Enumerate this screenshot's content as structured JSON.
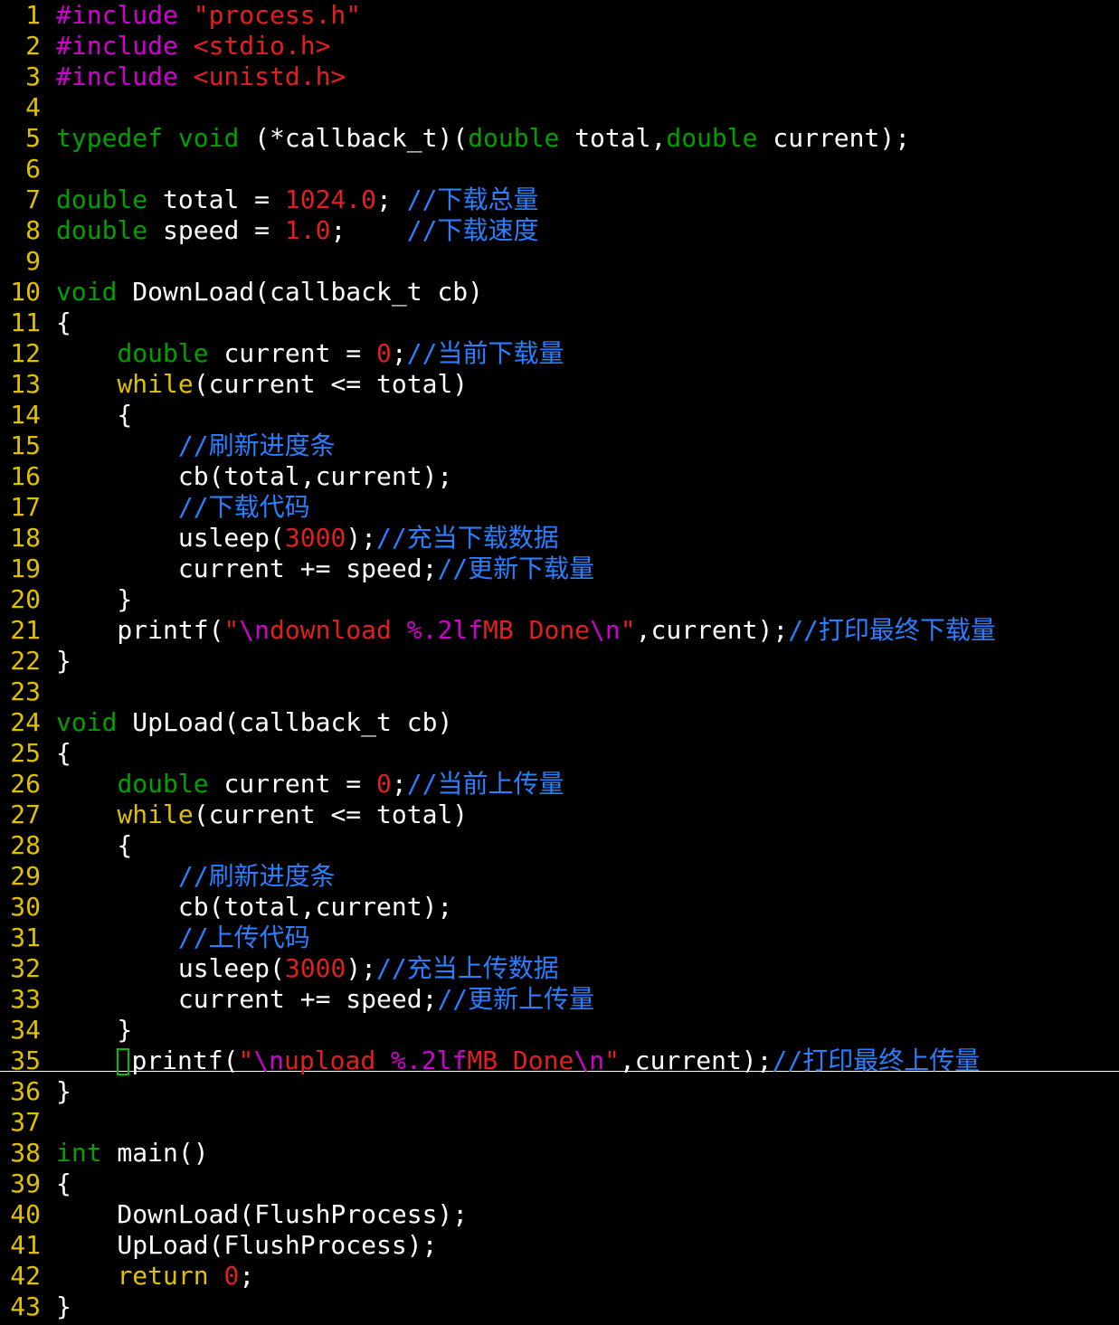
{
  "lines": [
    {
      "n": "1",
      "tokens": [
        [
          "pre",
          "#include "
        ],
        [
          "str",
          "\"process.h\""
        ]
      ]
    },
    {
      "n": "2",
      "tokens": [
        [
          "pre",
          "#include "
        ],
        [
          "str",
          "<stdio.h>"
        ]
      ]
    },
    {
      "n": "3",
      "tokens": [
        [
          "pre",
          "#include "
        ],
        [
          "str",
          "<unistd.h>"
        ]
      ]
    },
    {
      "n": "4",
      "tokens": []
    },
    {
      "n": "5",
      "tokens": [
        [
          "kw",
          "typedef"
        ],
        [
          "txt",
          " "
        ],
        [
          "kw",
          "void"
        ],
        [
          "txt",
          " (*callback_t)("
        ],
        [
          "kw",
          "double"
        ],
        [
          "txt",
          " total,"
        ],
        [
          "kw",
          "double"
        ],
        [
          "txt",
          " current);"
        ]
      ]
    },
    {
      "n": "6",
      "tokens": []
    },
    {
      "n": "7",
      "tokens": [
        [
          "kw",
          "double"
        ],
        [
          "txt",
          " total = "
        ],
        [
          "num",
          "1024.0"
        ],
        [
          "txt",
          "; "
        ],
        [
          "cmt",
          "//下载总量"
        ]
      ]
    },
    {
      "n": "8",
      "tokens": [
        [
          "kw",
          "double"
        ],
        [
          "txt",
          " speed = "
        ],
        [
          "num",
          "1.0"
        ],
        [
          "txt",
          ";    "
        ],
        [
          "cmt",
          "//下载速度"
        ]
      ]
    },
    {
      "n": "9",
      "tokens": []
    },
    {
      "n": "10",
      "tokens": [
        [
          "kw",
          "void"
        ],
        [
          "txt",
          " DownLoad(callback_t cb)"
        ]
      ]
    },
    {
      "n": "11",
      "tokens": [
        [
          "txt",
          "{"
        ]
      ]
    },
    {
      "n": "12",
      "tokens": [
        [
          "txt",
          "    "
        ],
        [
          "kw",
          "double"
        ],
        [
          "txt",
          " current = "
        ],
        [
          "num",
          "0"
        ],
        [
          "txt",
          ";"
        ],
        [
          "cmt",
          "//当前下载量"
        ]
      ]
    },
    {
      "n": "13",
      "tokens": [
        [
          "txt",
          "    "
        ],
        [
          "wkw",
          "while"
        ],
        [
          "txt",
          "(current <= total)"
        ]
      ]
    },
    {
      "n": "14",
      "tokens": [
        [
          "txt",
          "    {"
        ]
      ]
    },
    {
      "n": "15",
      "tokens": [
        [
          "txt",
          "        "
        ],
        [
          "cmt",
          "//刷新进度条"
        ]
      ]
    },
    {
      "n": "16",
      "tokens": [
        [
          "txt",
          "        cb(total,current);"
        ]
      ]
    },
    {
      "n": "17",
      "tokens": [
        [
          "txt",
          "        "
        ],
        [
          "cmt",
          "//下载代码"
        ]
      ]
    },
    {
      "n": "18",
      "tokens": [
        [
          "txt",
          "        usleep("
        ],
        [
          "num",
          "3000"
        ],
        [
          "txt",
          ");"
        ],
        [
          "cmt",
          "//充当下载数据"
        ]
      ]
    },
    {
      "n": "19",
      "tokens": [
        [
          "txt",
          "        current += speed;"
        ],
        [
          "cmt",
          "//更新下载量"
        ]
      ]
    },
    {
      "n": "20",
      "tokens": [
        [
          "txt",
          "    }"
        ]
      ]
    },
    {
      "n": "21",
      "tokens": [
        [
          "txt",
          "    printf("
        ],
        [
          "str",
          "\""
        ],
        [
          "esc",
          "\\n"
        ],
        [
          "str",
          "download "
        ],
        [
          "esc",
          "%.2lf"
        ],
        [
          "str",
          "MB Done"
        ],
        [
          "esc",
          "\\n"
        ],
        [
          "str",
          "\""
        ],
        [
          "txt",
          ",current);"
        ],
        [
          "cmt",
          "//打印最终下载量"
        ]
      ]
    },
    {
      "n": "22",
      "tokens": [
        [
          "txt",
          "}"
        ]
      ]
    },
    {
      "n": "23",
      "tokens": []
    },
    {
      "n": "24",
      "tokens": [
        [
          "kw",
          "void"
        ],
        [
          "txt",
          " UpLoad(callback_t cb)"
        ]
      ]
    },
    {
      "n": "25",
      "tokens": [
        [
          "txt",
          "{"
        ]
      ]
    },
    {
      "n": "26",
      "tokens": [
        [
          "txt",
          "    "
        ],
        [
          "kw",
          "double"
        ],
        [
          "txt",
          " current = "
        ],
        [
          "num",
          "0"
        ],
        [
          "txt",
          ";"
        ],
        [
          "cmt",
          "//当前上传量"
        ]
      ]
    },
    {
      "n": "27",
      "tokens": [
        [
          "txt",
          "    "
        ],
        [
          "wkw",
          "while"
        ],
        [
          "txt",
          "(current <= total)"
        ]
      ]
    },
    {
      "n": "28",
      "tokens": [
        [
          "txt",
          "    {"
        ]
      ]
    },
    {
      "n": "29",
      "tokens": [
        [
          "txt",
          "        "
        ],
        [
          "cmt",
          "//刷新进度条"
        ]
      ]
    },
    {
      "n": "30",
      "tokens": [
        [
          "txt",
          "        cb(total,current);"
        ]
      ]
    },
    {
      "n": "31",
      "tokens": [
        [
          "txt",
          "        "
        ],
        [
          "cmt",
          "//上传代码"
        ]
      ]
    },
    {
      "n": "32",
      "tokens": [
        [
          "txt",
          "        usleep("
        ],
        [
          "num",
          "3000"
        ],
        [
          "txt",
          ");"
        ],
        [
          "cmt",
          "//充当上传数据"
        ]
      ]
    },
    {
      "n": "33",
      "tokens": [
        [
          "txt",
          "        current += speed;"
        ],
        [
          "cmt",
          "//更新上传量"
        ]
      ]
    },
    {
      "n": "34",
      "tokens": [
        [
          "txt",
          "    }"
        ]
      ]
    },
    {
      "n": "35",
      "cursor": true,
      "tokens": [
        [
          "txt",
          "    "
        ],
        [
          "cursor",
          ""
        ],
        [
          "txt",
          "printf("
        ],
        [
          "str",
          "\""
        ],
        [
          "esc",
          "\\n"
        ],
        [
          "str",
          "upload "
        ],
        [
          "esc",
          "%.2lf"
        ],
        [
          "str",
          "MB Done"
        ],
        [
          "esc",
          "\\n"
        ],
        [
          "str",
          "\""
        ],
        [
          "txt",
          ",current);"
        ],
        [
          "cmt",
          "//打印最终上传量"
        ]
      ]
    },
    {
      "n": "36",
      "tokens": [
        [
          "txt",
          "}"
        ]
      ]
    },
    {
      "n": "37",
      "tokens": []
    },
    {
      "n": "38",
      "tokens": [
        [
          "kw",
          "int"
        ],
        [
          "txt",
          " main()"
        ]
      ]
    },
    {
      "n": "39",
      "tokens": [
        [
          "txt",
          "{"
        ]
      ]
    },
    {
      "n": "40",
      "tokens": [
        [
          "txt",
          "    DownLoad(FlushProcess);"
        ]
      ]
    },
    {
      "n": "41",
      "tokens": [
        [
          "txt",
          "    UpLoad(FlushProcess);"
        ]
      ]
    },
    {
      "n": "42",
      "tokens": [
        [
          "txt",
          "    "
        ],
        [
          "wkw",
          "return"
        ],
        [
          "txt",
          " "
        ],
        [
          "num",
          "0"
        ],
        [
          "txt",
          ";"
        ]
      ]
    },
    {
      "n": "43",
      "tokens": [
        [
          "txt",
          "}"
        ]
      ]
    }
  ]
}
